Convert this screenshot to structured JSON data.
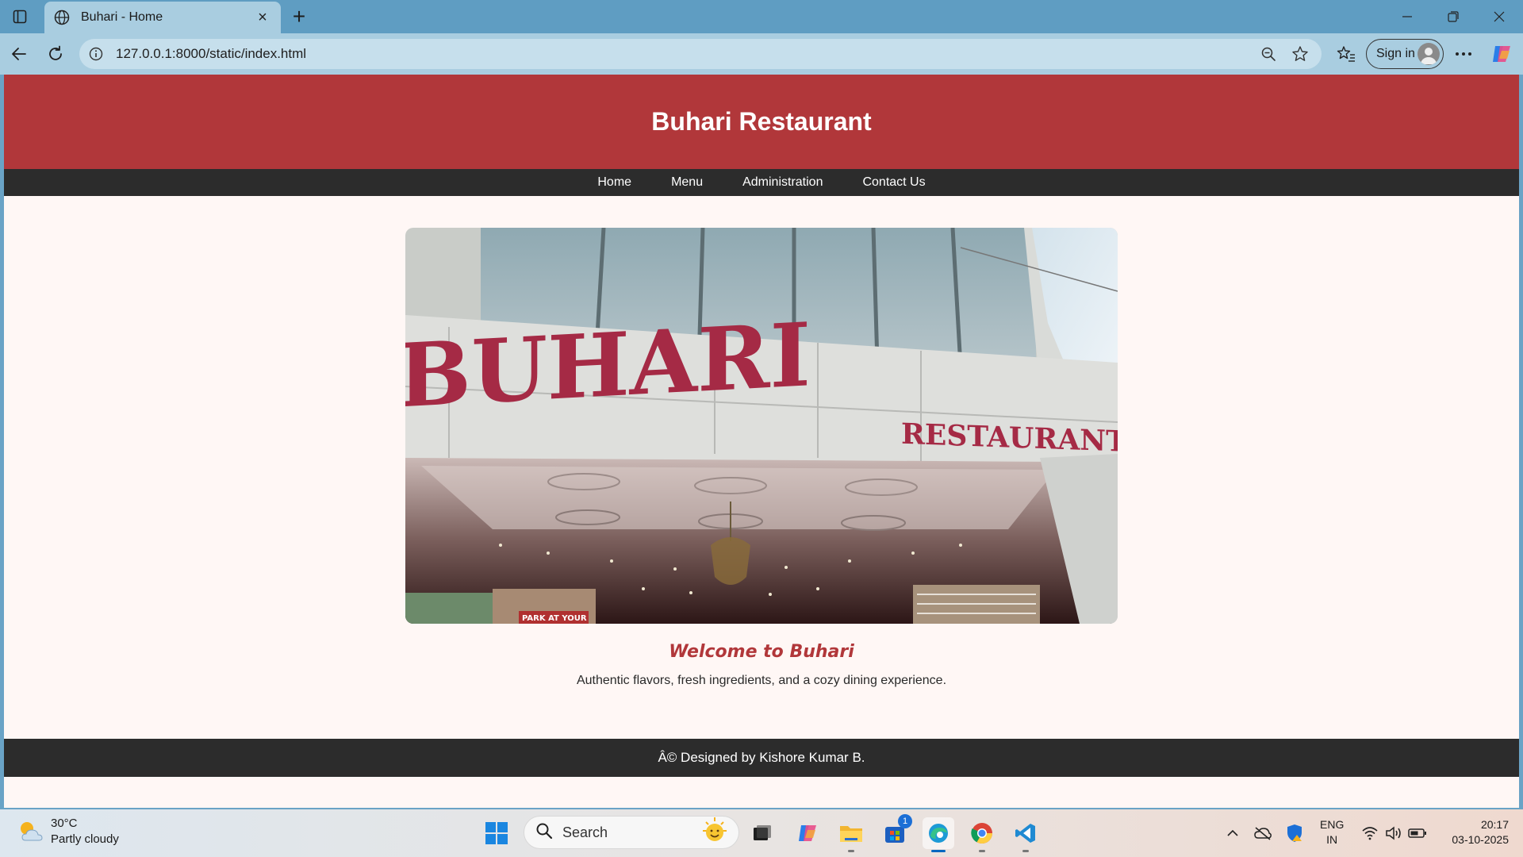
{
  "browser": {
    "tab_title": "Buhari - Home",
    "url": "127.0.0.1:8000/static/index.html",
    "signin_label": "Sign in"
  },
  "site": {
    "title": "Buhari Restaurant",
    "nav": [
      "Home",
      "Menu",
      "Administration",
      "Contact Us"
    ],
    "welcome": "Welcome to Buhari",
    "tagline": "Authentic flavors, fresh ingredients, and a cozy dining experience.",
    "footer": "Â© Designed by Kishore Kumar B.",
    "hero_sign_main": "BUHARI",
    "hero_sign_sub": "RESTAURANT",
    "hero_small_sign": "PARK AT YOUR",
    "colors": {
      "brand": "#b1373a",
      "nav_bg": "#2c2c2c",
      "page_bg": "#fff7f5"
    }
  },
  "taskbar": {
    "weather_temp": "30°C",
    "weather_desc": "Partly cloudy",
    "search_label": "Search",
    "store_badge": "1",
    "lang_line1": "ENG",
    "lang_line2": "IN",
    "time": "20:17",
    "date": "03-10-2025"
  },
  "icons": [
    "sidebar-toggle-icon",
    "globe-icon",
    "close-icon",
    "plus-icon",
    "minimize-icon",
    "restore-icon",
    "back-icon",
    "reload-icon",
    "info-icon",
    "zoom-out-icon",
    "star-icon",
    "favorites-icon",
    "more-icon",
    "copilot-icon",
    "weather-icon",
    "windows-icon",
    "search-icon",
    "task-view-icon",
    "file-explorer-icon",
    "store-icon",
    "edge-icon",
    "chrome-icon",
    "vscode-icon",
    "chevron-up-icon",
    "cloud-icon",
    "shield-icon",
    "wifi-icon",
    "volume-icon",
    "battery-icon"
  ]
}
